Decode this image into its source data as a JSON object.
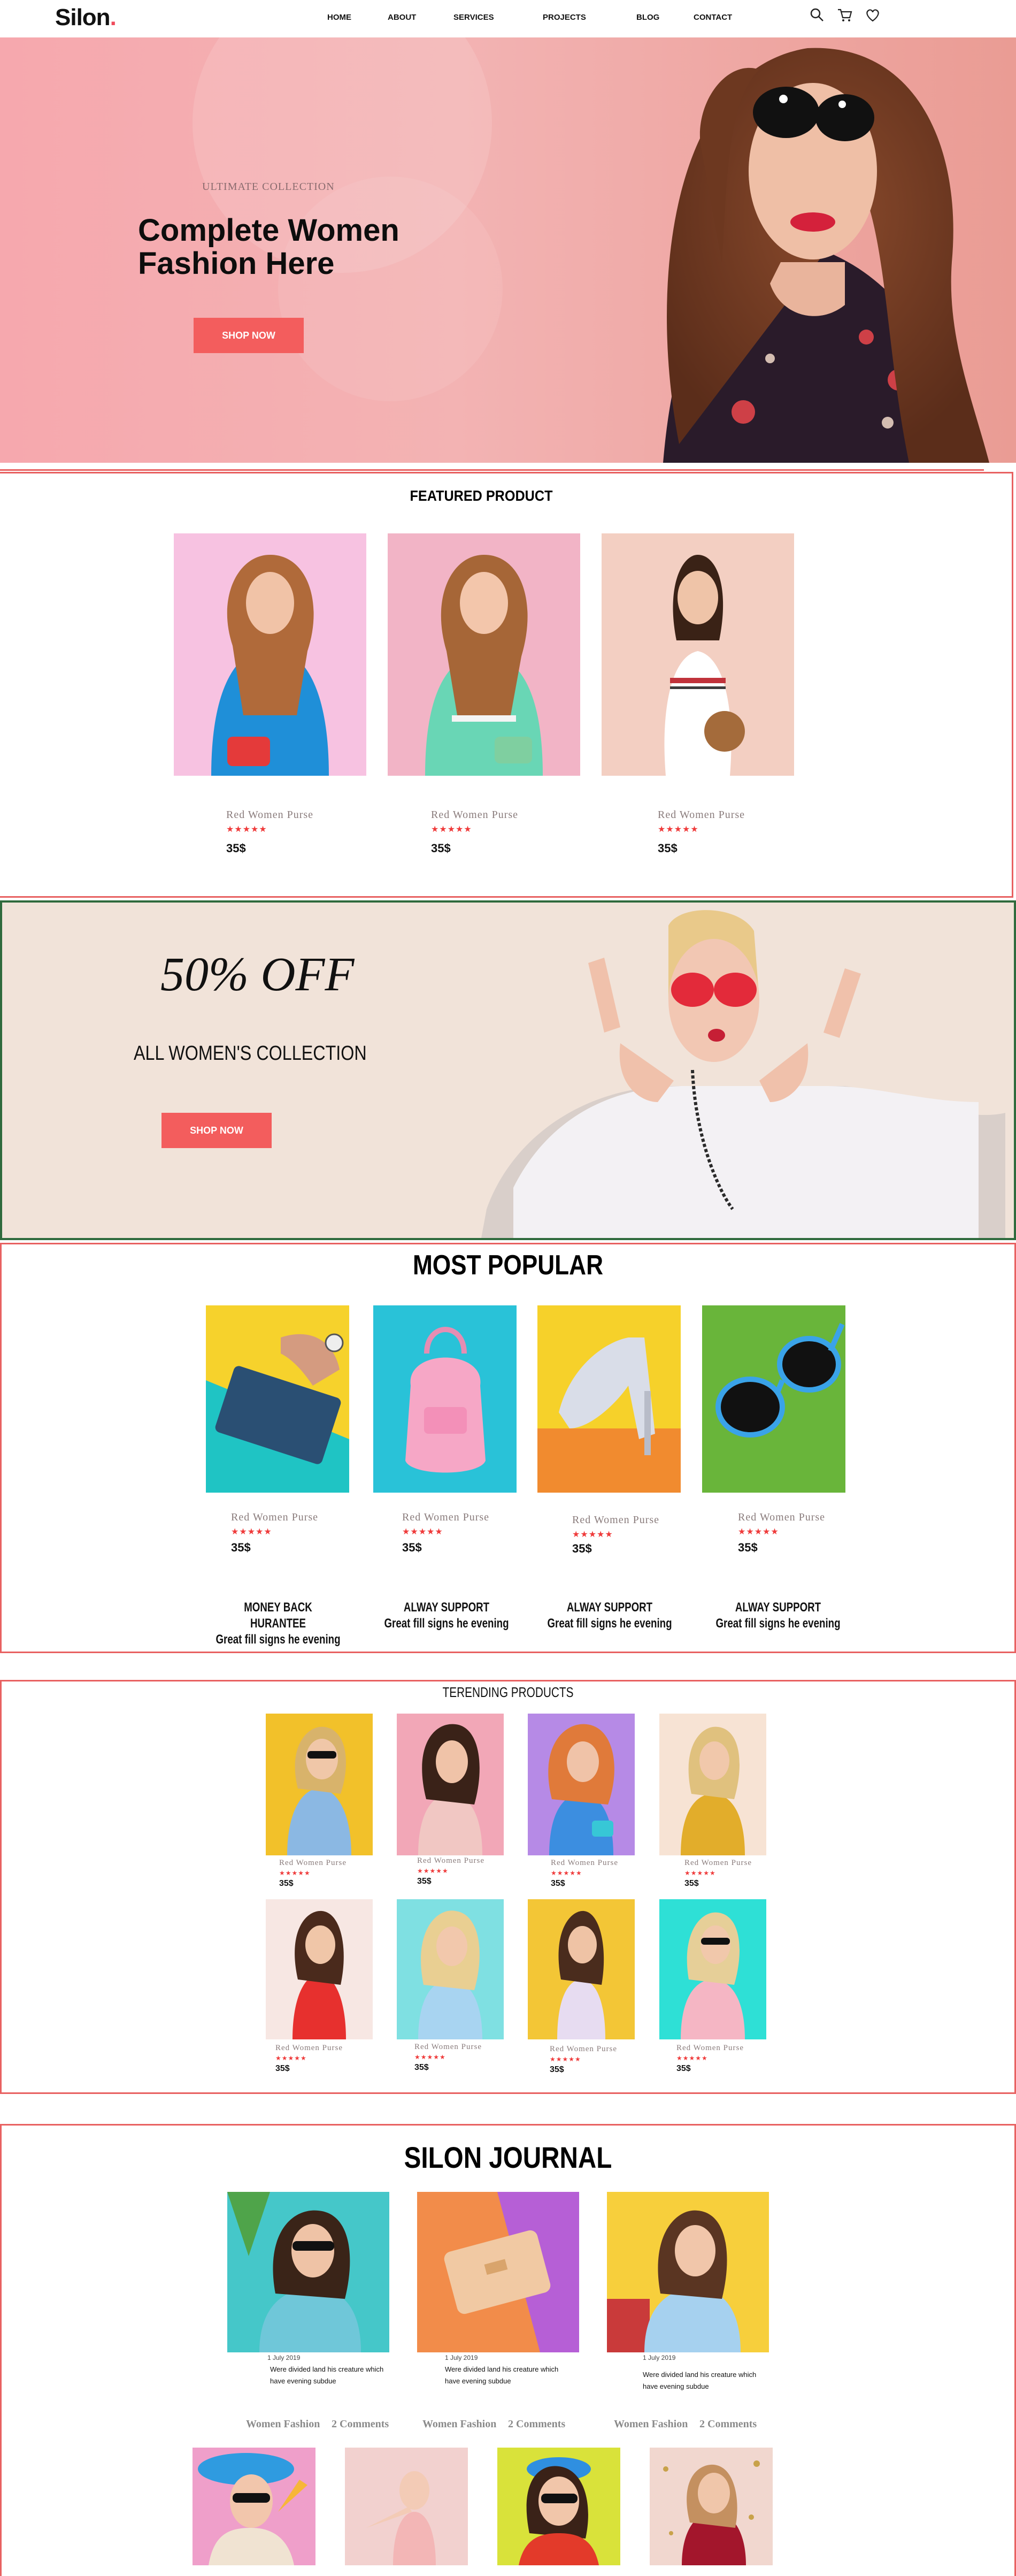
{
  "brand": {
    "name": "Silon",
    "dot": ".",
    "accent": "#ef4a5a"
  },
  "nav": {
    "links": [
      "HOME",
      "ABOUT",
      "SERVICES",
      "PROJECTS",
      "BLOG",
      "CONTACT"
    ],
    "icons": [
      "search-icon",
      "cart-icon",
      "heart-icon"
    ]
  },
  "hero": {
    "kicker": "ULTIMATE   COLLECTION",
    "title_line1": "Complete Women",
    "title_line2": "Fashion Here",
    "button": "SHOP NOW"
  },
  "featured": {
    "title": "FEATURED PRODUCT",
    "items": [
      {
        "name": "Red Women Purse",
        "stars": "★★★★★",
        "price": "35$"
      },
      {
        "name": "Red Women Purse",
        "stars": "★★★★★",
        "price": "35$"
      },
      {
        "name": "Red Women Purse",
        "stars": "★★★★★",
        "price": "35$"
      }
    ]
  },
  "sale": {
    "off": "50% OFF",
    "subtitle": "ALL WOMEN'S COLLECTION",
    "button": "SHOP NOW"
  },
  "popular": {
    "title": "MOST POPULAR",
    "items": [
      {
        "name": "Red Women Purse",
        "stars": "★★★★★",
        "price": "35$"
      },
      {
        "name": "Red Women Purse",
        "stars": "★★★★★",
        "price": "35$"
      },
      {
        "name": "Red Women Purse",
        "stars": "★★★★★",
        "price": "35$"
      },
      {
        "name": "Red Women Purse",
        "stars": "★★★★★",
        "price": "35$"
      }
    ],
    "features": [
      {
        "title": "MONEY BACK HURANTEE",
        "text": "Great fill signs he evening"
      },
      {
        "title": "ALWAY SUPPORT",
        "text": "Great fill signs he evening"
      },
      {
        "title": "ALWAY SUPPORT",
        "text": "Great fill signs he evening"
      },
      {
        "title": "ALWAY SUPPORT",
        "text": "Great fill signs he evening"
      }
    ]
  },
  "trending": {
    "title": "TERENDING PRODUCTS",
    "items": [
      {
        "name": "Red Women Purse",
        "stars": "★★★★★",
        "price": "35$"
      },
      {
        "name": "Red Women Purse",
        "stars": "★★★★★",
        "price": "35$"
      },
      {
        "name": "Red Women Purse",
        "stars": "★★★★★",
        "price": "35$"
      },
      {
        "name": "Red Women Purse",
        "stars": "★★★★★",
        "price": "35$"
      },
      {
        "name": "Red Women Purse",
        "stars": "★★★★★",
        "price": "35$"
      },
      {
        "name": "Red Women Purse",
        "stars": "★★★★★",
        "price": "35$"
      },
      {
        "name": "Red Women Purse",
        "stars": "★★★★★",
        "price": "35$"
      },
      {
        "name": "Red Women Purse",
        "stars": "★★★★★",
        "price": "35$"
      }
    ]
  },
  "journal": {
    "title": "SILON JOURNAL",
    "posts": [
      {
        "date": "1 July 2019",
        "line1": "Were divided land his creature which",
        "line2": "have evening subdue",
        "tag": "Women Fashion",
        "comments": "2 Comments"
      },
      {
        "date": "1 July 2019",
        "line1": "Were divided land his creature which",
        "line2": "have evening subdue",
        "tag": "Women Fashion",
        "comments": "2 Comments"
      },
      {
        "date": "1 July 2019",
        "line1": "Were divided land his creature which",
        "line2": "have evening subdue",
        "tag": "Women Fashion",
        "comments": "2 Comments"
      }
    ]
  }
}
